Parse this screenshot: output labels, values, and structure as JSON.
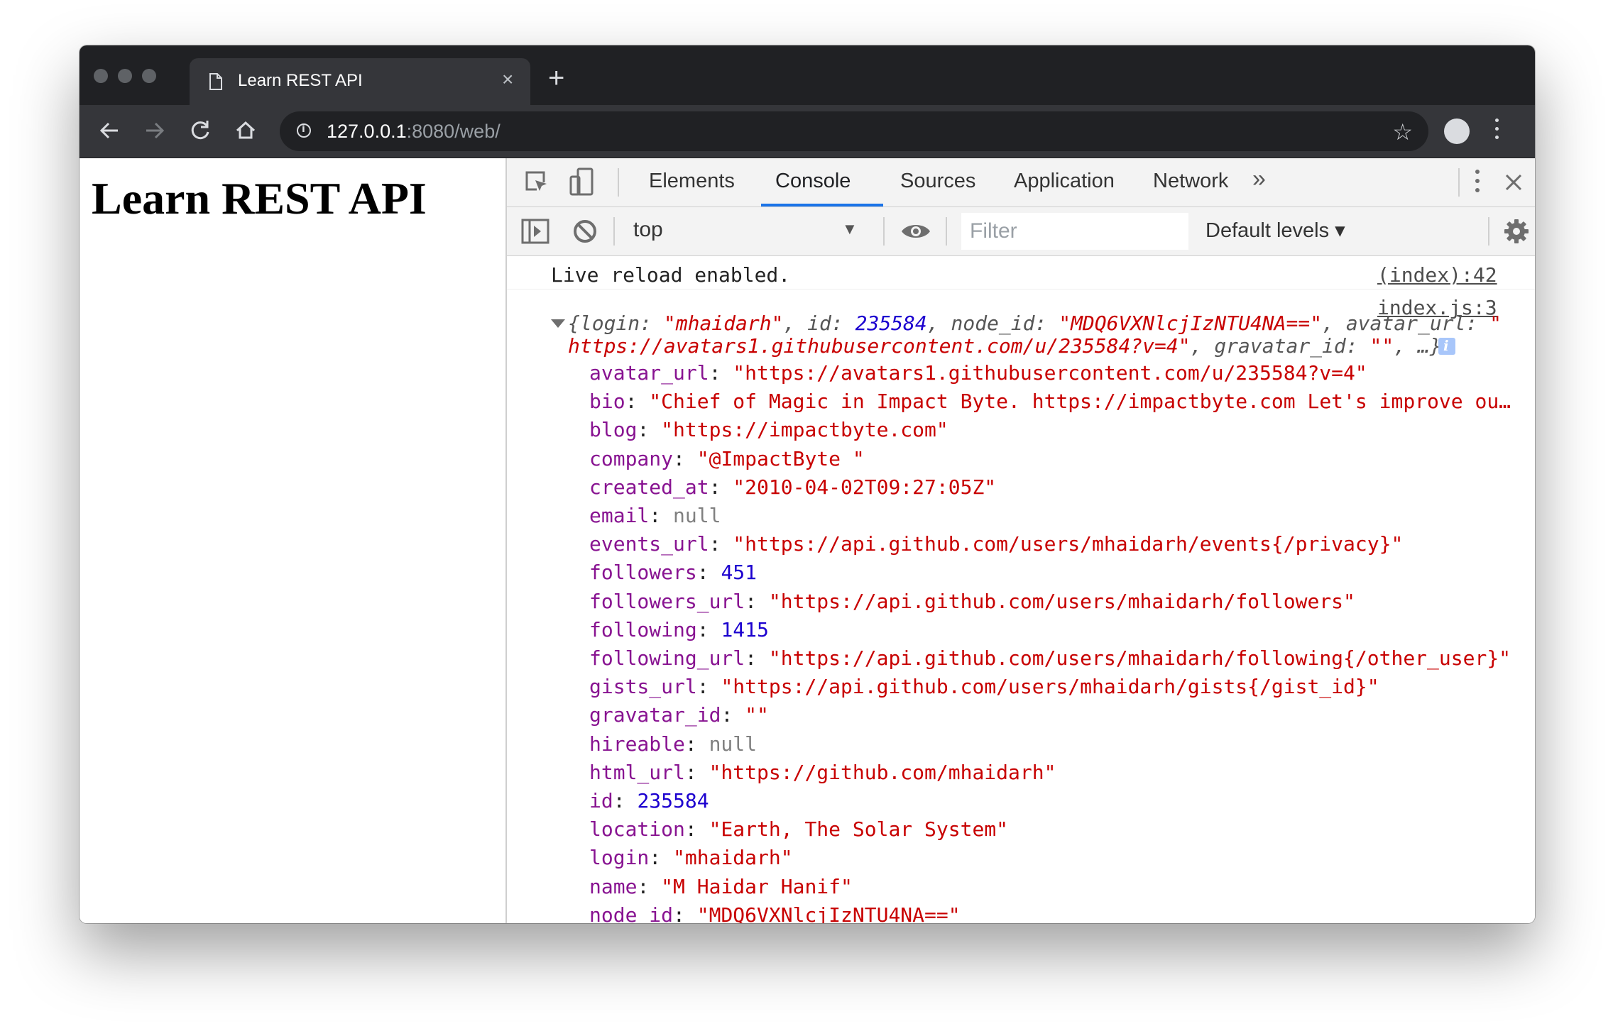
{
  "browser": {
    "tab_title": "Learn REST API",
    "tab_close": "×",
    "new_tab": "+",
    "url_host": "127.0.0.1",
    "url_rest": ":8080/web/"
  },
  "page": {
    "heading": "Learn REST API"
  },
  "devtools": {
    "tabs": [
      "Elements",
      "Console",
      "Sources",
      "Application",
      "Network"
    ],
    "more_tabs": "»",
    "active_tab": "Console",
    "context": "top",
    "context_caret": "▼",
    "filter_placeholder": "Filter",
    "levels": "Default levels ▾"
  },
  "console": {
    "msg1": {
      "text": "Live reload enabled.",
      "source": "(index):42"
    },
    "msg2_source": "index.js:3",
    "summary": {
      "line1": [
        "{",
        "login",
        ": ",
        "\"mhaidarh\"",
        ", ",
        "id",
        ": ",
        "235584",
        ", ",
        "node_id",
        ": ",
        "\"MDQ6VXNlcjIzNTU4NA==\"",
        ", ",
        "avatar_url",
        ": ",
        "\""
      ],
      "line2": [
        "https://avatars1.githubusercontent.com/u/235584?v=4\"",
        ", ",
        "gravatar_id",
        ": ",
        "\"\"",
        ", …}"
      ]
    },
    "info_badge": "i",
    "properties": [
      {
        "key": "avatar_url",
        "value": "\"https://avatars1.githubusercontent.com/u/235584?v=4\"",
        "type": "string"
      },
      {
        "key": "bio",
        "value": "\"Chief of Magic in Impact Byte. https://impactbyte.com Let's improve ou…",
        "type": "string"
      },
      {
        "key": "blog",
        "value": "\"https://impactbyte.com\"",
        "type": "string"
      },
      {
        "key": "company",
        "value": "\"@ImpactByte \"",
        "type": "string"
      },
      {
        "key": "created_at",
        "value": "\"2010-04-02T09:27:05Z\"",
        "type": "string"
      },
      {
        "key": "email",
        "value": "null",
        "type": "null"
      },
      {
        "key": "events_url",
        "value": "\"https://api.github.com/users/mhaidarh/events{/privacy}\"",
        "type": "string"
      },
      {
        "key": "followers",
        "value": "451",
        "type": "number"
      },
      {
        "key": "followers_url",
        "value": "\"https://api.github.com/users/mhaidarh/followers\"",
        "type": "string"
      },
      {
        "key": "following",
        "value": "1415",
        "type": "number"
      },
      {
        "key": "following_url",
        "value": "\"https://api.github.com/users/mhaidarh/following{/other_user}\"",
        "type": "string"
      },
      {
        "key": "gists_url",
        "value": "\"https://api.github.com/users/mhaidarh/gists{/gist_id}\"",
        "type": "string"
      },
      {
        "key": "gravatar_id",
        "value": "\"\"",
        "type": "string"
      },
      {
        "key": "hireable",
        "value": "null",
        "type": "null"
      },
      {
        "key": "html_url",
        "value": "\"https://github.com/mhaidarh\"",
        "type": "string"
      },
      {
        "key": "id",
        "value": "235584",
        "type": "number"
      },
      {
        "key": "location",
        "value": "\"Earth, The Solar System\"",
        "type": "string"
      },
      {
        "key": "login",
        "value": "\"mhaidarh\"",
        "type": "string"
      },
      {
        "key": "name",
        "value": "\"M Haidar Hanif\"",
        "type": "string"
      },
      {
        "key": "node_id",
        "value": "\"MDQ6VXNlcjIzNTU4NA==\"",
        "type": "string"
      }
    ]
  },
  "colors": {
    "key": "#881391",
    "string": "#c80000",
    "number": "#1c00cf",
    "null": "#808080",
    "accent": "#1a73e8"
  }
}
